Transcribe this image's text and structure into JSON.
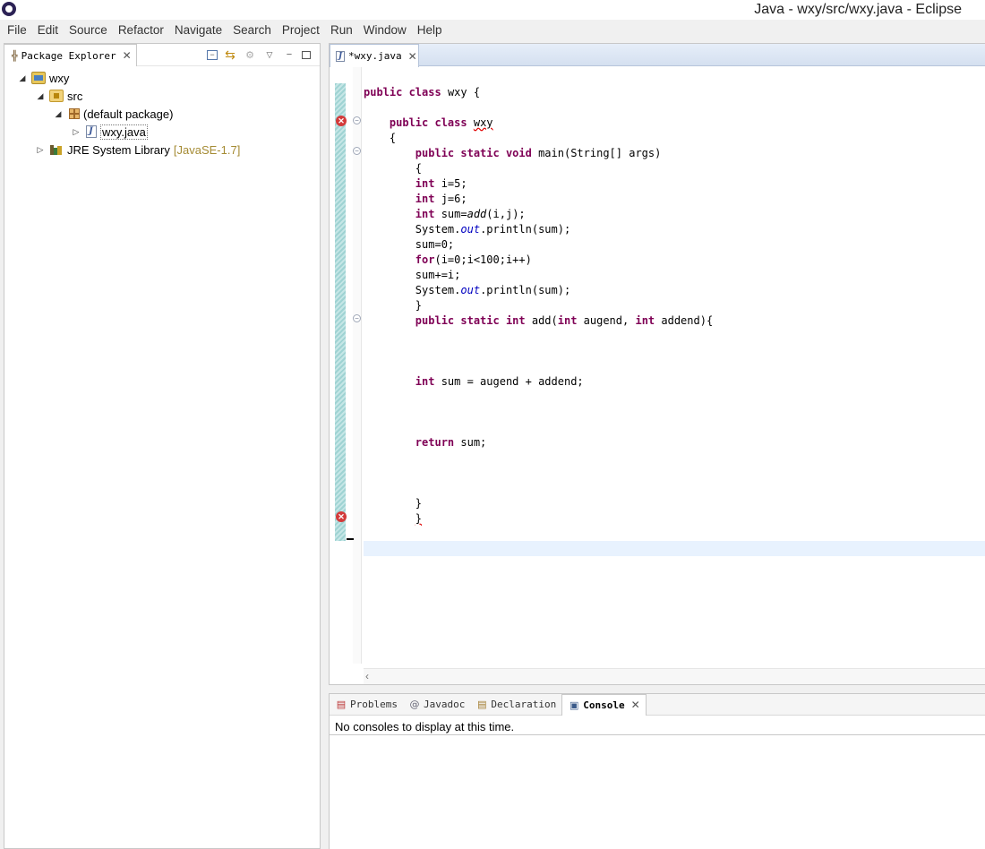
{
  "window": {
    "title": "Java - wxy/src/wxy.java - Eclipse"
  },
  "menu": [
    "File",
    "Edit",
    "Source",
    "Refactor",
    "Navigate",
    "Search",
    "Project",
    "Run",
    "Window",
    "Help"
  ],
  "explorer": {
    "tab_label": "Package Explorer",
    "tree": [
      {
        "label": "wxy",
        "extra": "",
        "icon": "project-icon"
      },
      {
        "label": "src",
        "extra": "",
        "icon": "source-folder-icon"
      },
      {
        "label": "(default package)",
        "extra": "",
        "icon": "package-icon"
      },
      {
        "label": "wxy.java",
        "extra": "",
        "icon": "java-file-icon"
      },
      {
        "label": "JRE System Library",
        "extra": "[JavaSE-1.7]",
        "icon": "library-icon"
      }
    ]
  },
  "editor": {
    "tab_label": "*wxy.java",
    "code_lines": [
      "public class wxy {",
      "",
      "    public class wxy",
      "    {",
      "        public static void main(String[] args)",
      "        {",
      "        int i=5;",
      "        int j=6;",
      "        int sum=add(i,j);",
      "        System.out.println(sum);",
      "        sum=0;",
      "        for(i=0;i<100;i++)",
      "        sum+=i;",
      "        System.out.println(sum);",
      "        }",
      "        public static int add(int augend, int addend){",
      "",
      "",
      "",
      "        int sum = augend + addend;",
      "",
      "",
      "",
      "        return sum;",
      "",
      "",
      "",
      "        }",
      "        }"
    ]
  },
  "bottom_panel": {
    "tabs": [
      "Problems",
      "Javadoc",
      "Declaration",
      "Console"
    ],
    "active_tab": "Console",
    "console_message": "No consoles to display at this time."
  },
  "colors": {
    "keyword": "#7f0055",
    "static_field": "#0000c0",
    "error": "#d33a3a",
    "library_version": "#a58b34"
  }
}
